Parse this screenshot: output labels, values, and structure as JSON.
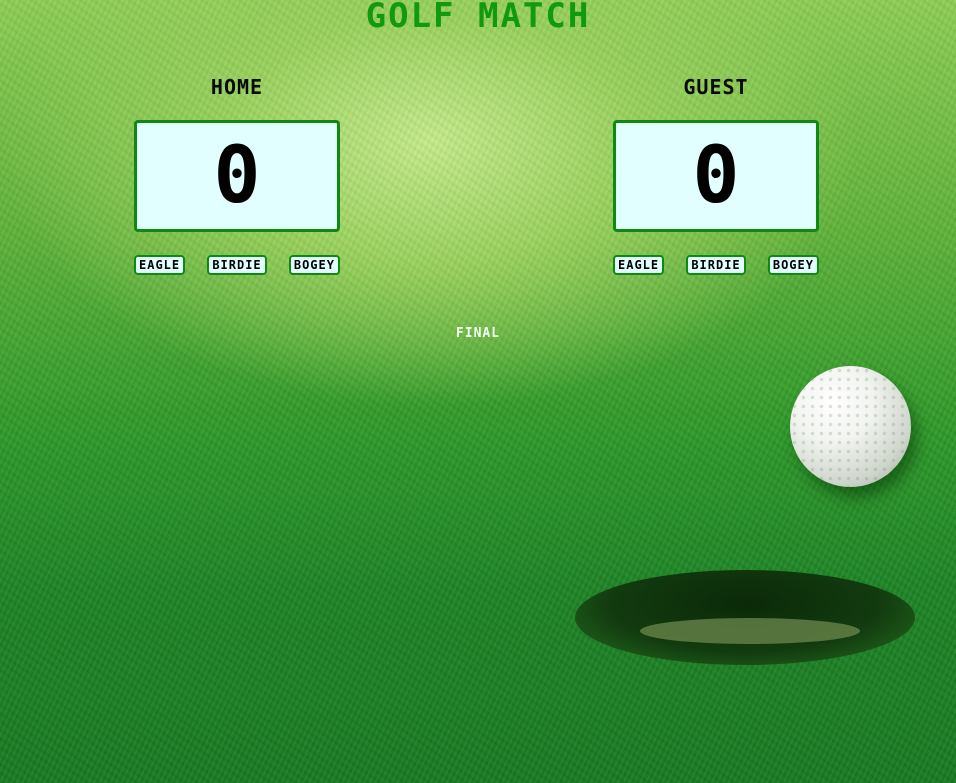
{
  "title": "GOLF MATCH",
  "home": {
    "label": "HOME",
    "score": "0",
    "buttons": {
      "eagle": "EAGLE",
      "birdie": "BIRDIE",
      "bogey": "BOGEY"
    }
  },
  "guest": {
    "label": "GUEST",
    "score": "0",
    "buttons": {
      "eagle": "EAGLE",
      "birdie": "BIRDIE",
      "bogey": "BOGEY"
    }
  },
  "final_label": "FINAL",
  "colors": {
    "accent": "#109a10",
    "score_box_bg": "#e0fffe",
    "score_box_border": "#0e8a14",
    "final_text": "#f2fff2"
  }
}
